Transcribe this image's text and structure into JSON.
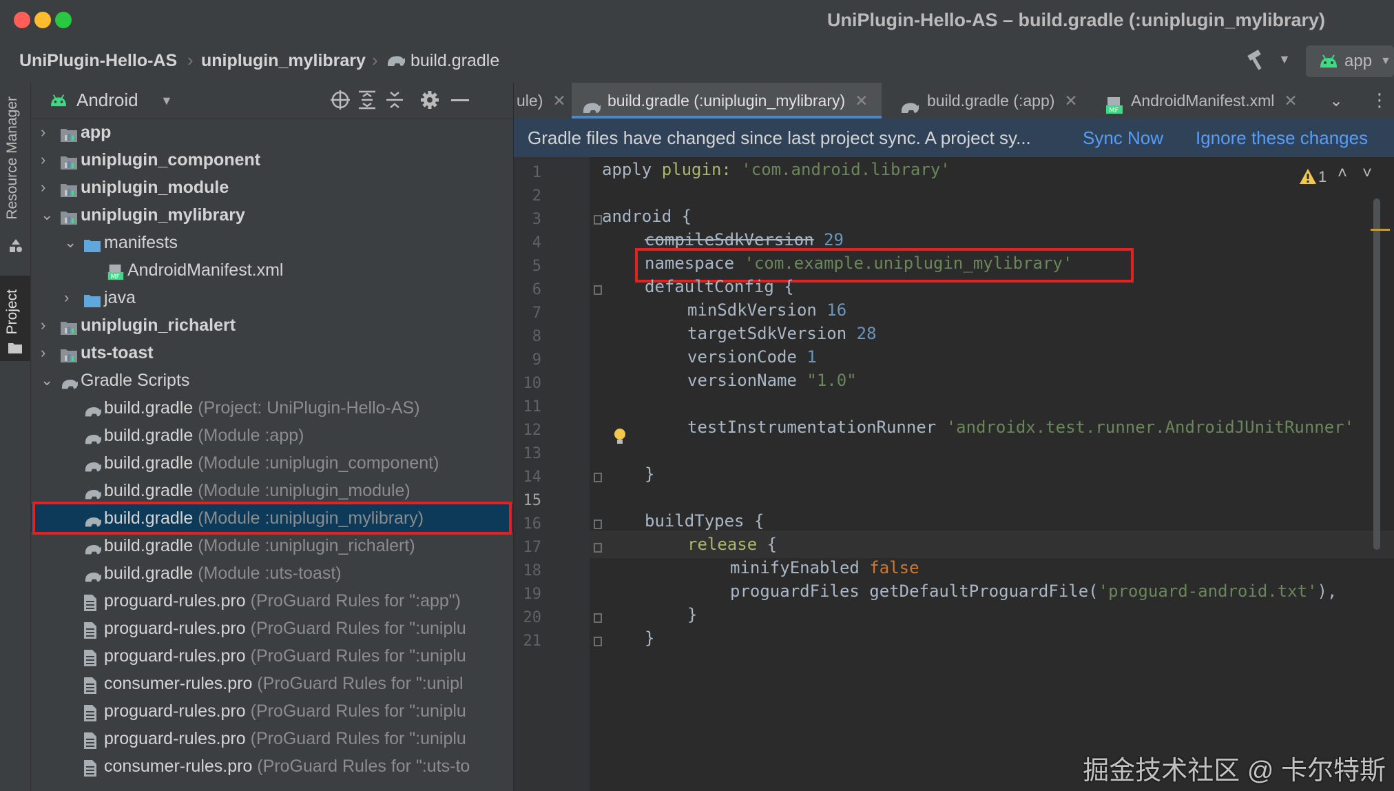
{
  "window": {
    "title": "UniPlugin-Hello-AS – build.gradle (:uniplugin_mylibrary)"
  },
  "breadcrumb": [
    "UniPlugin-Hello-AS",
    "uniplugin_mylibrary",
    "build.gradle"
  ],
  "run_config": "app",
  "side_tabs": [
    "Resource Manager",
    "Project"
  ],
  "panel": {
    "view": "Android"
  },
  "tree": [
    {
      "label": "app",
      "extra": "",
      "bold": true
    },
    {
      "label": "uniplugin_component",
      "extra": "",
      "bold": true
    },
    {
      "label": "uniplugin_module",
      "extra": "",
      "bold": true
    },
    {
      "label": "uniplugin_mylibrary",
      "extra": "",
      "bold": true
    },
    {
      "label": "manifests",
      "extra": "",
      "bold": false
    },
    {
      "label": "AndroidManifest.xml",
      "extra": "",
      "bold": false
    },
    {
      "label": "java",
      "extra": "",
      "bold": false
    },
    {
      "label": "uniplugin_richalert",
      "extra": "",
      "bold": true
    },
    {
      "label": "uts-toast",
      "extra": "",
      "bold": true
    },
    {
      "label": "Gradle Scripts",
      "extra": "",
      "bold": false
    },
    {
      "label": "build.gradle",
      "extra": " (Project: UniPlugin-Hello-AS)",
      "bold": false
    },
    {
      "label": "build.gradle",
      "extra": " (Module :app)",
      "bold": false
    },
    {
      "label": "build.gradle",
      "extra": " (Module :uniplugin_component)",
      "bold": false
    },
    {
      "label": "build.gradle",
      "extra": " (Module :uniplugin_module)",
      "bold": false
    },
    {
      "label": "build.gradle",
      "extra": " (Module :uniplugin_mylibrary)",
      "bold": false
    },
    {
      "label": "build.gradle",
      "extra": " (Module :uniplugin_richalert)",
      "bold": false
    },
    {
      "label": "build.gradle",
      "extra": " (Module :uts-toast)",
      "bold": false
    },
    {
      "label": "proguard-rules.pro",
      "extra": " (ProGuard Rules for \":app\")",
      "bold": false
    },
    {
      "label": "proguard-rules.pro",
      "extra": " (ProGuard Rules for \":uniplu",
      "bold": false
    },
    {
      "label": "proguard-rules.pro",
      "extra": " (ProGuard Rules for \":uniplu",
      "bold": false
    },
    {
      "label": "consumer-rules.pro",
      "extra": " (ProGuard Rules for \":unipl",
      "bold": false
    },
    {
      "label": "proguard-rules.pro",
      "extra": " (ProGuard Rules for \":uniplu",
      "bold": false
    },
    {
      "label": "proguard-rules.pro",
      "extra": " (ProGuard Rules for \":uniplu",
      "bold": false
    },
    {
      "label": "consumer-rules.pro",
      "extra": " (ProGuard Rules for \":uts-to",
      "bold": false
    }
  ],
  "tabs": [
    {
      "label": "ule)"
    },
    {
      "label": "build.gradle (:uniplugin_mylibrary)"
    },
    {
      "label": "build.gradle (:app)"
    },
    {
      "label": "AndroidManifest.xml"
    }
  ],
  "banner": {
    "message": "Gradle files have changed since last project sync. A project sy...",
    "sync_now": "Sync Now",
    "ignore": "Ignore these changes"
  },
  "inspection": {
    "warnings": "1"
  },
  "line_numbers": [
    "1",
    "2",
    "3",
    "4",
    "5",
    "6",
    "7",
    "8",
    "9",
    "10",
    "11",
    "12",
    "13",
    "14",
    "15",
    "16",
    "17",
    "18",
    "19",
    "20",
    "21"
  ],
  "code": {
    "l1_a": "apply",
    "l1_b": " plugin: ",
    "l1_c": "'com.android.library'",
    "l3": "android {",
    "l4_a": "compileSdkVersion",
    "l4_b": " 29",
    "l5_a": "namespace ",
    "l5_b": "'com.example.uniplugin_mylibrary'",
    "l6": "defaultConfig {",
    "l7_a": "minSdkVersion ",
    "l7_b": "16",
    "l8_a": "targetSdkVersion ",
    "l8_b": "28",
    "l9_a": "versionCode ",
    "l9_b": "1",
    "l10_a": "versionName ",
    "l10_b": "\"1.0\"",
    "l12_a": "testInstrumentationRunner ",
    "l12_b": "'androidx.test.runner.AndroidJUnitRunner'",
    "l14": "}",
    "l16": "buildTypes {",
    "l17_a": "release",
    "l17_b": " {",
    "l18_a": "minifyEnabled ",
    "l18_b": "false",
    "l19_a": "proguardFiles getDefaultProguardFile(",
    "l19_b": "'proguard-android.txt'",
    "l19_c": "),",
    "l20": "}",
    "l21": "}"
  },
  "watermark": "掘金技术社区 @ 卡尔特斯",
  "colors": {
    "accent": "#4a88c7",
    "highlight_box": "#e5211f",
    "selection": "#0d3a58"
  }
}
